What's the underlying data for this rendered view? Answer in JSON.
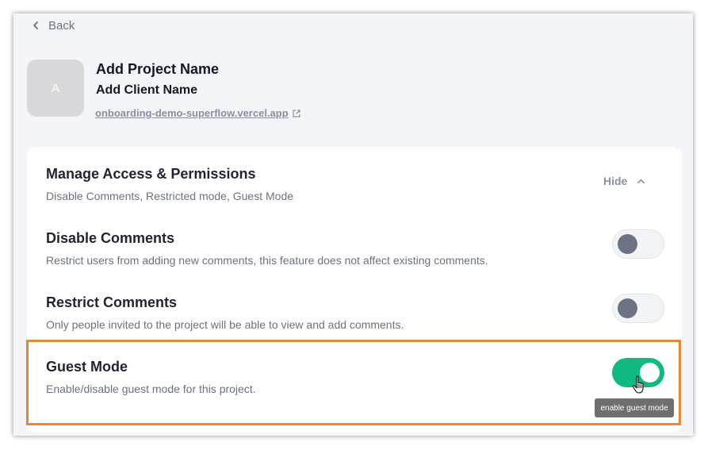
{
  "nav": {
    "back_label": "Back"
  },
  "project": {
    "avatar_initial": "A",
    "name": "Add Project Name",
    "client": "Add Client Name",
    "url": "onboarding-demo-superflow.vercel.app"
  },
  "permissions": {
    "title": "Manage Access & Permissions",
    "summary": "Disable Comments, Restricted mode, Guest Mode",
    "hide_label": "Hide",
    "settings": [
      {
        "title": "Disable Comments",
        "description": "Restrict users from adding new comments, this feature does not affect existing comments.",
        "enabled": false
      },
      {
        "title": "Restrict Comments",
        "description": "Only people invited to the project will be able to view and add comments.",
        "enabled": false
      },
      {
        "title": "Guest Mode",
        "description": "Enable/disable guest mode for this project.",
        "enabled": true
      }
    ]
  },
  "tooltip": {
    "text": "enable guest mode"
  },
  "colors": {
    "accent_green": "#10b981",
    "highlight_orange": "#e8863a"
  },
  "icons": [
    "chevron-left-icon",
    "external-link-icon",
    "chevron-up-icon",
    "hand-cursor-icon"
  ]
}
